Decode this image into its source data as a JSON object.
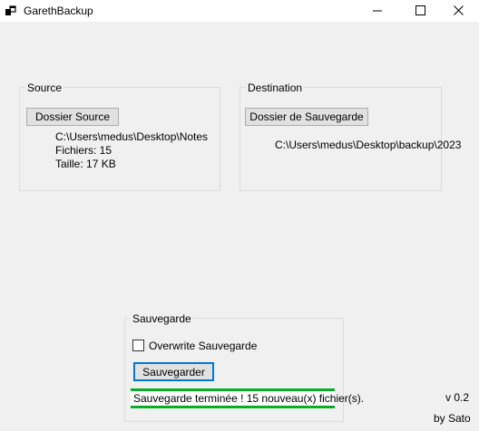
{
  "window": {
    "title": "GarethBackup"
  },
  "source": {
    "legend": "Source",
    "button_label": "Dossier Source",
    "path": "C:\\Users\\medus\\Desktop\\Notes",
    "files_label": "Fichiers: 15",
    "size_label": "Taille: 17 KB"
  },
  "destination": {
    "legend": "Destination",
    "button_label": "Dossier de Sauvegarde",
    "path": "C:\\Users\\medus\\Desktop\\backup\\2023"
  },
  "backup": {
    "legend": "Sauvegarde",
    "overwrite_label": "Overwrite Sauvegarde",
    "overwrite_checked": false,
    "save_button_label": "Sauvegarder",
    "status_text": "Sauvegarde terminée ! 15 nouveau(x) fichier(s)."
  },
  "footer": {
    "version": "v 0.2",
    "author": "by Sato"
  },
  "colors": {
    "background": "#f0f0f0",
    "accent_focus": "#0078d7",
    "progress_green": "#06b025"
  }
}
